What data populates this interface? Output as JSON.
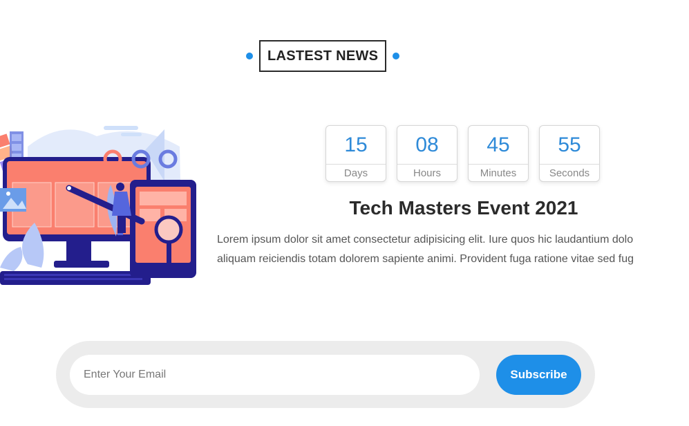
{
  "section": {
    "heading": "LASTEST NEWS"
  },
  "countdown": [
    {
      "value": "15",
      "label": "Days"
    },
    {
      "value": "08",
      "label": "Hours"
    },
    {
      "value": "45",
      "label": "Minutes"
    },
    {
      "value": "55",
      "label": "Seconds"
    }
  ],
  "event": {
    "title": "Tech Masters Event 2021",
    "description_line1": "Lorem ipsum dolor sit amet consectetur adipisicing elit. Iure quos hic laudantium dolo",
    "description_line2": "aliquam reiciendis totam dolorem sapiente animi. Provident fuga ratione vitae sed fug"
  },
  "subscribe": {
    "placeholder": "Enter Your Email",
    "button_label": "Subscribe"
  },
  "colors": {
    "accent": "#1e8fe8",
    "number": "#2e8ad8",
    "subscribe_bar": "#ececec",
    "illustration_screen": "#fa7f6e",
    "illustration_navy": "#231e8c"
  },
  "illustration": {
    "icon": "web-design-illustration"
  }
}
